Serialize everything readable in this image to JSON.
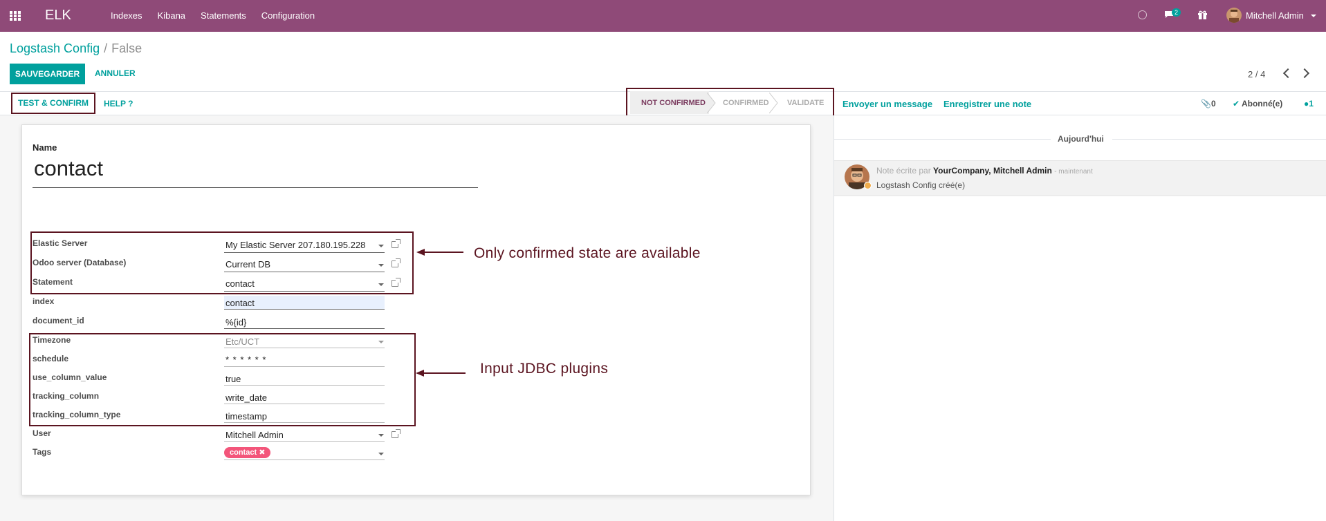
{
  "navbar": {
    "brand": "ELK",
    "menu": [
      "Indexes",
      "Kibana",
      "Statements",
      "Configuration"
    ],
    "messages_badge": "2",
    "user_name": "Mitchell Admin",
    "color": "#8f4a78"
  },
  "breadcrumb": {
    "parent": "Logstash Config",
    "separator": "/",
    "current": "False"
  },
  "buttons": {
    "save": "SAUVEGARDER",
    "cancel": "ANNULER",
    "test_confirm": "TEST & CONFIRM",
    "help": "HELP ?"
  },
  "pager": {
    "value": "2 / 4"
  },
  "statusbar": {
    "stages": [
      "NOT CONFIRMED",
      "CONFIRMED",
      "VALIDATE"
    ],
    "active": "NOT CONFIRMED"
  },
  "form": {
    "name_label": "Name",
    "name_value": "contact",
    "fields": [
      {
        "label": "Elastic Server",
        "value": "My Elastic Server 207.180.195.228"
      },
      {
        "label": "Odoo server (Database)",
        "value": "Current DB"
      },
      {
        "label": "Statement",
        "value": "contact"
      },
      {
        "label": "index",
        "value": "contact"
      },
      {
        "label": "document_id",
        "value": "%{id}"
      },
      {
        "label": "Timezone",
        "value": "Etc/UCT"
      },
      {
        "label": "schedule",
        "value": "* * * * * *"
      },
      {
        "label": "use_column_value",
        "value": "true"
      },
      {
        "label": "tracking_column",
        "value": "write_date"
      },
      {
        "label": "tracking_column_type",
        "value": "timestamp"
      },
      {
        "label": "User",
        "value": "Mitchell Admin"
      },
      {
        "label": "Tags",
        "value": "contact"
      }
    ]
  },
  "annotations": {
    "first": "Only confirmed state are available",
    "second": "Input JDBC plugins"
  },
  "chatter": {
    "send_message": "Envoyer un message",
    "log_note": "Enregistrer une note",
    "attachments": "0",
    "follow": "Abonné(e)",
    "followers": "1",
    "today": "Aujourd'hui",
    "message": {
      "prefix": "Note écrite par",
      "author": "YourCompany, Mitchell Admin",
      "time": "- maintenant",
      "body": "Logstash Config créé(e)"
    }
  },
  "colors": {
    "accent": "#00a09d",
    "annotation": "#5b1420",
    "tag": "#f3557a"
  }
}
